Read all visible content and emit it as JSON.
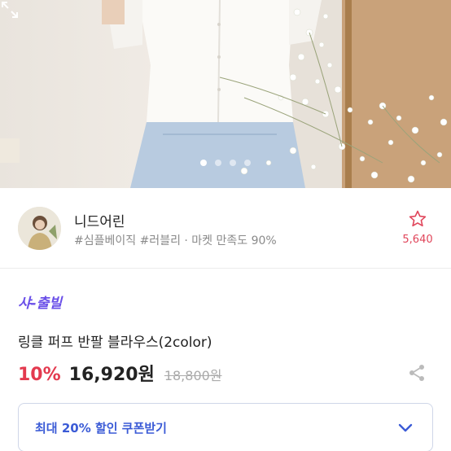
{
  "gallery": {
    "dots": [
      true,
      false,
      false,
      false
    ],
    "expand_icon": "expand-icon"
  },
  "store": {
    "name": "니드어린",
    "tags": "#심플베이직 #러블리 · 마켓 만족도 90%",
    "favorite_count": "5,640",
    "favorite_icon": "star-icon"
  },
  "product": {
    "badge": "샤-출빌",
    "name": "링클 퍼프 반팔 블라우스(2color)",
    "discount": "10%",
    "price": "16,920원",
    "original_price": "18,800원",
    "share_icon": "share-icon"
  },
  "coupon": {
    "label": "최대 20% 할인 쿠폰받기",
    "icon": "chevron-down-icon"
  },
  "colors": {
    "accent_red": "#e33a4f",
    "badge_purple": "#6a4fe8",
    "coupon_blue": "#3b5bd6"
  }
}
